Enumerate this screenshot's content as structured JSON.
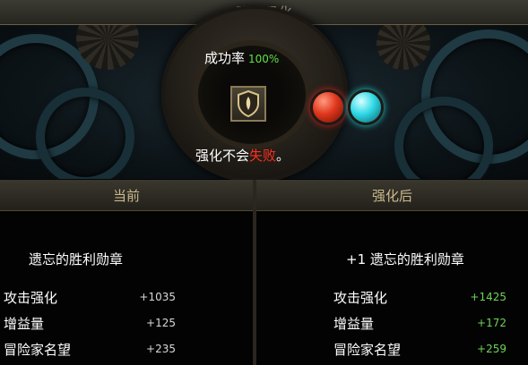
{
  "window": {
    "title": "勋章强化"
  },
  "machine": {
    "success_label": "成功率",
    "success_rate": "100%",
    "note_prefix": "强化不会",
    "note_warn": "失败",
    "note_suffix": "。",
    "orbs": {
      "red": "#e0361c",
      "cyan": "#2ed8e6"
    }
  },
  "current": {
    "header": "当前",
    "item_name": "遗忘的胜利勋章",
    "stats": [
      {
        "label": "攻击强化",
        "value": "+1035"
      },
      {
        "label": "增益量",
        "value": "+125"
      },
      {
        "label": "冒险家名望",
        "value": "+235"
      }
    ]
  },
  "after": {
    "header": "强化后",
    "item_name": "+1 遗忘的胜利勋章",
    "stats": [
      {
        "label": "攻击强化",
        "value": "+1425"
      },
      {
        "label": "增益量",
        "value": "+172"
      },
      {
        "label": "冒险家名望",
        "value": "+259"
      }
    ]
  },
  "colors": {
    "positive": "#6fd35a",
    "warning": "#ff2e1e",
    "header_text": "#c9b98e"
  }
}
